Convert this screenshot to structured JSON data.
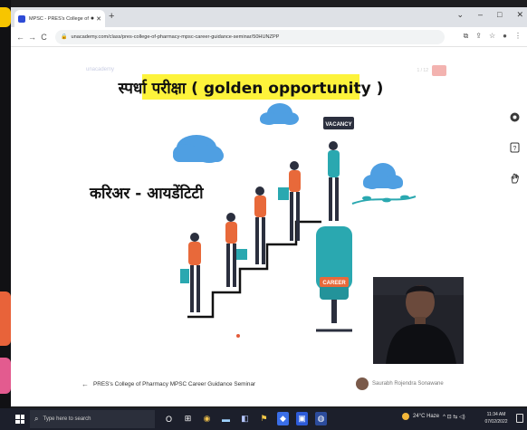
{
  "browser": {
    "tab_title": "MPSC - PRES's College of Ph",
    "tab_dot": "●",
    "tab_close": "✕",
    "new_tab": "+",
    "win_min": "–",
    "win_max": "□",
    "win_close": "✕",
    "tab_menu": "⌄",
    "back": "←",
    "forward": "→",
    "reload": "C",
    "lock": "🔒",
    "url": "unacademy.com/class/pres-college-of-pharmacy-mpsc-career-guidance-seminar/50HUNZPP",
    "toolbar_icons": [
      "⧉",
      "⇪",
      "☆",
      "●",
      "⋮"
    ]
  },
  "slide": {
    "logo_text": "unacademy",
    "top_right_text": "1 / 12",
    "headline": "स्पर्धा परीक्षा ( golden  opportunity )",
    "career_identity": "करिअर - आयडेंटिटी",
    "sign_vacancy": "VACANCY",
    "sign_career": "CAREER"
  },
  "infobar": {
    "back_arrow": "←",
    "seminar_title": "PRES's College of Pharmacy MPSC Career Guidance Seminar",
    "host_name": "Saurabh Rojendra Sonawane"
  },
  "side_panel": {
    "icons": [
      "chat-icon",
      "help-icon",
      "hand-raise-icon",
      "exit-icon"
    ]
  },
  "taskbar": {
    "search_placeholder": "Type here to search",
    "apps": [
      "O",
      "⊞",
      "◉",
      "▬",
      "◧",
      "⚑",
      "◆",
      "▣",
      "◍"
    ],
    "weather": "24°C  Haze",
    "tray_icons": "^ ⊡ ⇆ ◁)",
    "time": "11:34 AM",
    "date": "07/02/2022"
  },
  "colors": {
    "headline_bg": "#fdf33b",
    "taskbar": "#1c1f2b",
    "accent_teal": "#2aa8b0",
    "accent_orange": "#e8693a",
    "cloud": "#4f9fe2"
  }
}
